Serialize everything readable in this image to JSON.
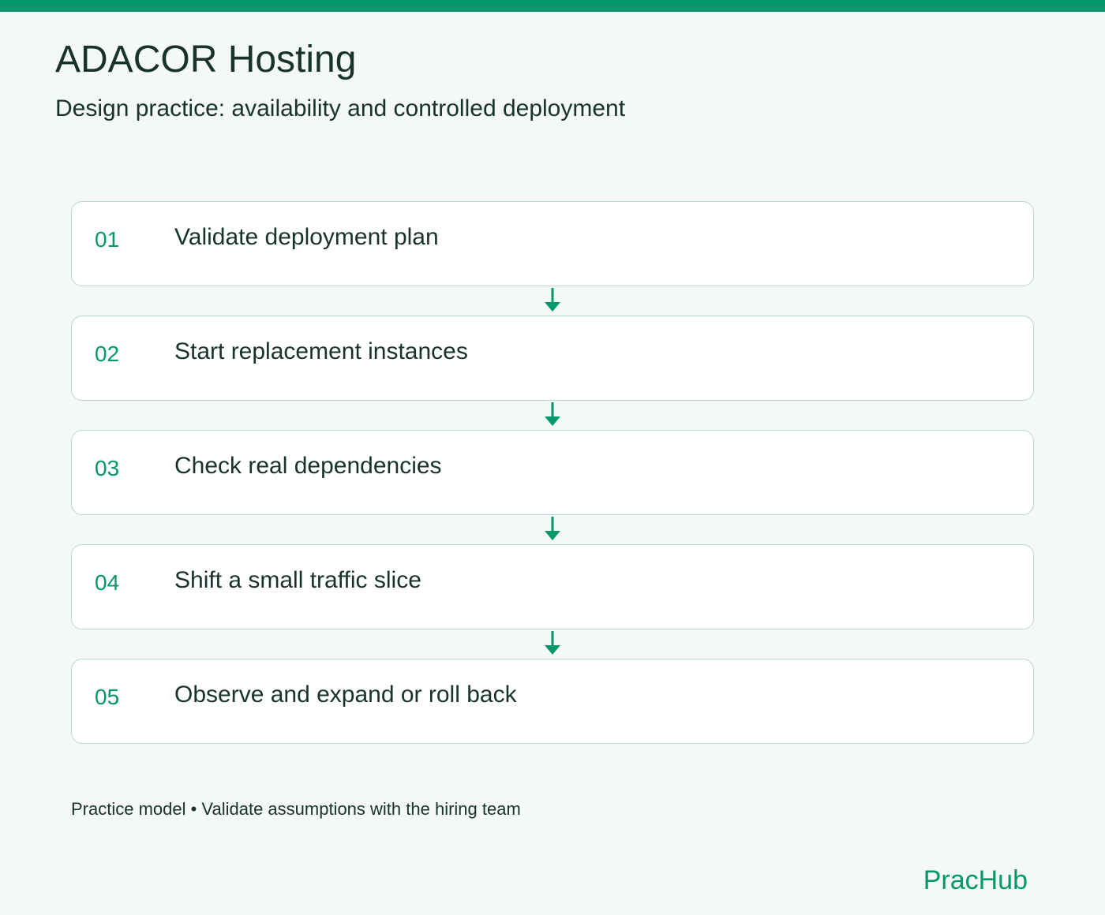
{
  "header": {
    "title": "ADACOR Hosting",
    "subtitle": "Design practice: availability and controlled deployment"
  },
  "steps": [
    {
      "number": "01",
      "label": "Validate deployment plan"
    },
    {
      "number": "02",
      "label": "Start replacement instances"
    },
    {
      "number": "03",
      "label": "Check real dependencies"
    },
    {
      "number": "04",
      "label": "Shift a small traffic slice"
    },
    {
      "number": "05",
      "label": "Observe and expand or roll back"
    }
  ],
  "footer": {
    "note": "Practice model • Validate assumptions with the hiring team",
    "brand": "PracHub"
  },
  "colors": {
    "accent": "#04976a",
    "text": "#18332b",
    "background": "#f4f8f6",
    "card_border": "#b9d9cd"
  },
  "icons": {
    "connector": "arrow-down-icon"
  }
}
